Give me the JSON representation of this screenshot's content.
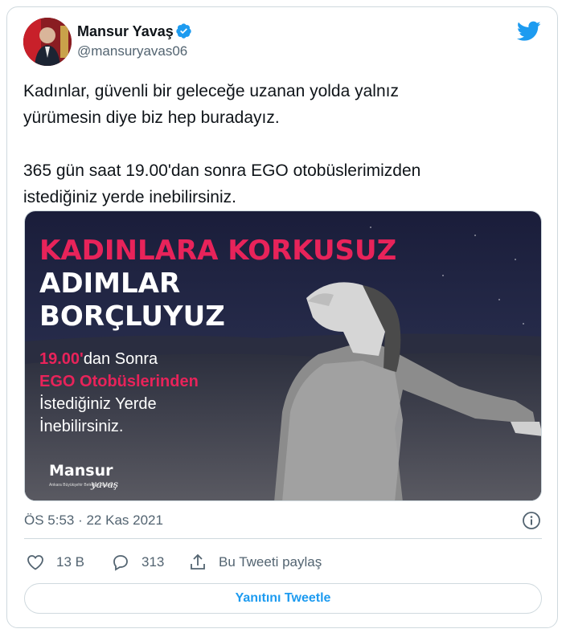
{
  "author": {
    "name": "Mansur Yavaş",
    "handle": "@mansuryavas06"
  },
  "tweet": {
    "text": "Kadınlar, güvenli bir geleceğe uzanan yolda yalnız\nyürümesin diye biz hep buradayız.\n\n365 gün saat 19.00'dan sonra EGO otobüslerimizden\nistediğiniz yerde inebilirsiniz.",
    "timestamp": "ÖS 5:53 · 22 Kas 2021"
  },
  "media": {
    "headline_1": "KADINLARA KORKUSUZ",
    "headline_2": "ADIMLAR",
    "headline_3": "BORÇLUYUZ",
    "line_time": "19.00'",
    "line_time_rest": "dan Sonra",
    "line_ego": "EGO Otobüslerinden",
    "line_3": "İstediğiniz Yerde",
    "line_4": "İnebilirsiniz.",
    "logo_name": "Mansur",
    "logo_sub": "Ankara Büyükşehir Belediye Başkanı",
    "logo_script": "yavaş",
    "colors": {
      "accent": "#e8235a",
      "night_sky": "#1e2340"
    }
  },
  "actions": {
    "likes": "13 B",
    "replies": "313",
    "share_label": "Bu Tweeti paylaş",
    "reply_button": "Yanıtını Tweetle"
  },
  "colors": {
    "twitter_blue": "#1d9bf0",
    "muted": "#536471",
    "border": "#cfd9de"
  }
}
